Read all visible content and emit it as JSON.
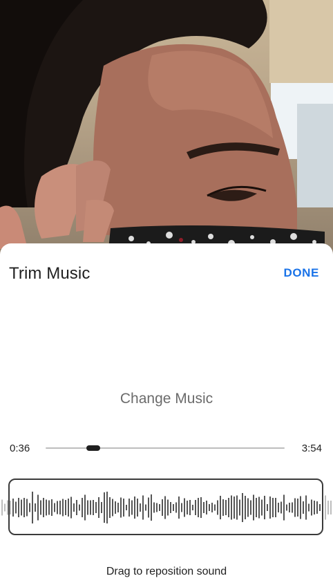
{
  "background": {
    "description_icon": "video-frame-image"
  },
  "sheet": {
    "title": "Trim Music",
    "done_label": "DONE",
    "change_music_label": "Change Music",
    "scrubber": {
      "start_time": "0:36",
      "end_time": "3:54",
      "position_fraction": 0.2
    },
    "hint": "Drag to reposition sound"
  },
  "colors": {
    "accent": "#1a73e8",
    "waveform_active": "#555555",
    "waveform_inactive": "#bdbdbd"
  }
}
